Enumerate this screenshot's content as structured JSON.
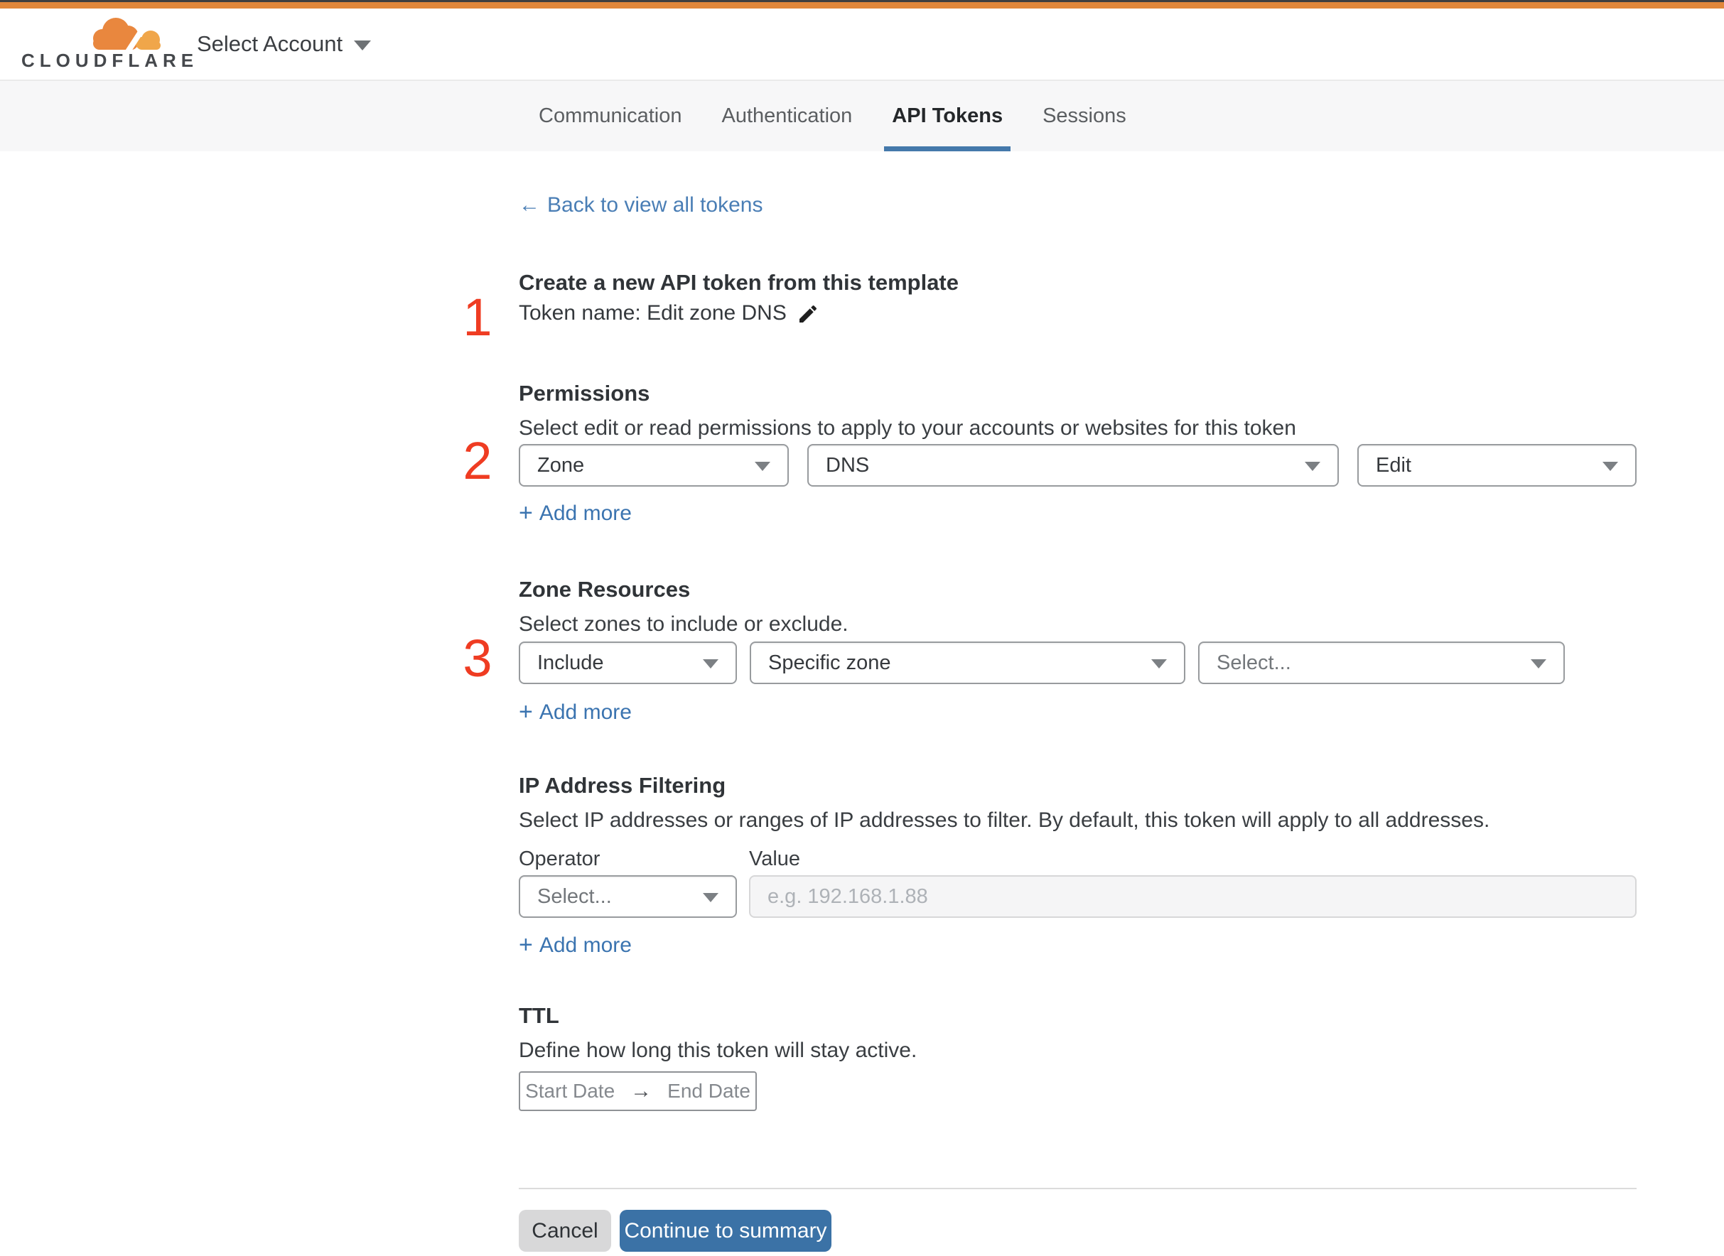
{
  "header": {
    "brand": "CLOUDFLARE",
    "account_selector": "Select Account"
  },
  "tabs": [
    {
      "label": "Communication",
      "active": false
    },
    {
      "label": "Authentication",
      "active": false
    },
    {
      "label": "API Tokens",
      "active": true
    },
    {
      "label": "Sessions",
      "active": false
    }
  ],
  "back_link": {
    "label": "Back to view all tokens"
  },
  "create_section": {
    "marker": "1",
    "heading": "Create a new API token from this template",
    "token_name": "Token name: Edit zone DNS"
  },
  "permissions": {
    "marker": "2",
    "heading": "Permissions",
    "description": "Select edit or read permissions to apply to your accounts or websites for this token",
    "selects": [
      {
        "value": "Zone"
      },
      {
        "value": "DNS"
      },
      {
        "value": "Edit"
      }
    ],
    "add_more": "Add more"
  },
  "zone_resources": {
    "marker": "3",
    "heading": "Zone Resources",
    "description": "Select zones to include or exclude.",
    "selects": [
      {
        "value": "Include"
      },
      {
        "value": "Specific zone"
      },
      {
        "value": "Select...",
        "placeholder": true
      }
    ],
    "add_more": "Add more"
  },
  "ip_filtering": {
    "heading": "IP Address Filtering",
    "description": "Select IP addresses or ranges of IP addresses to filter. By default, this token will apply to all addresses.",
    "operator_label": "Operator",
    "value_label": "Value",
    "operator_select": {
      "value": "Select...",
      "placeholder": true
    },
    "value_placeholder": "e.g. 192.168.1.88",
    "add_more": "Add more"
  },
  "ttl": {
    "heading": "TTL",
    "description": "Define how long this token will stay active.",
    "start_label": "Start Date",
    "end_label": "End Date"
  },
  "footer": {
    "cancel_label": "Cancel",
    "continue_label": "Continue to summary"
  },
  "icons": {
    "back_arrow": "←",
    "range_arrow": "→",
    "plus": "+"
  },
  "colors": {
    "top_bar_orange": "#e1873a",
    "marker_red": "#ef3c22",
    "link_blue": "#4a7eb5",
    "tab_underline": "#4579ab",
    "button_blue": "#3b72a6",
    "cancel_gray": "#d8d8d9"
  }
}
